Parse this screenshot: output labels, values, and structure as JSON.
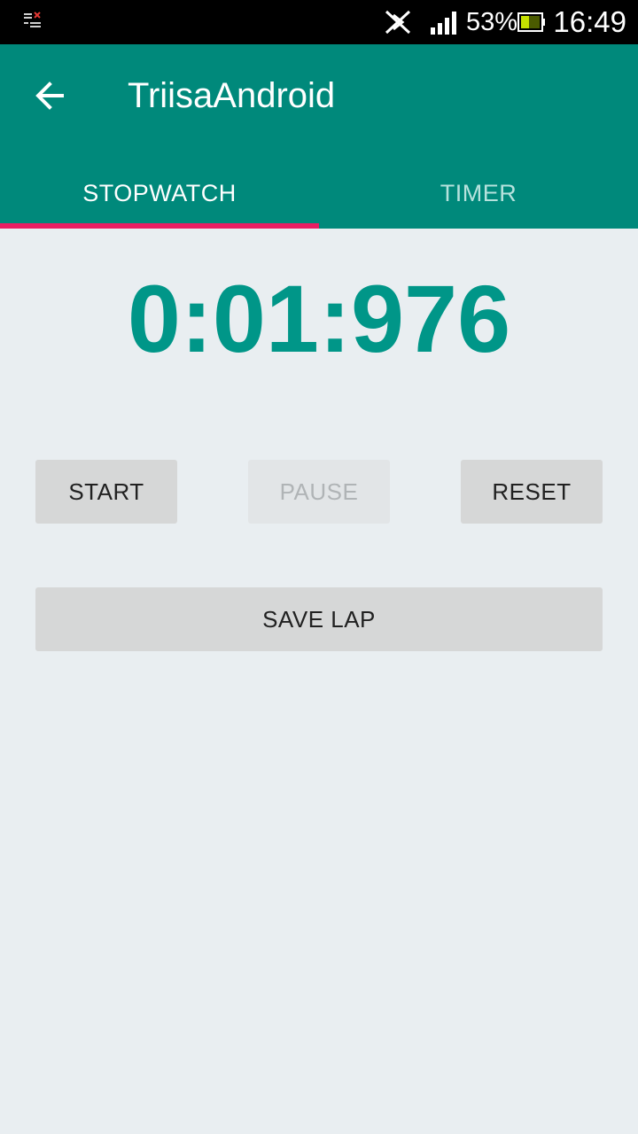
{
  "status_bar": {
    "battery_percent": "53%",
    "time": "16:49"
  },
  "toolbar": {
    "title": "TriisaAndroid"
  },
  "tabs": [
    {
      "label": "STOPWATCH",
      "selected": true
    },
    {
      "label": "TIMER",
      "selected": false
    }
  ],
  "stopwatch": {
    "display": "0:01:976"
  },
  "buttons": {
    "start": "START",
    "pause": "PAUSE",
    "reset": "RESET",
    "save_lap": "SAVE LAP"
  },
  "colors": {
    "primary": "#00897b",
    "accent": "#e91e63",
    "timer_text": "#009688",
    "background": "#e9eef1"
  }
}
